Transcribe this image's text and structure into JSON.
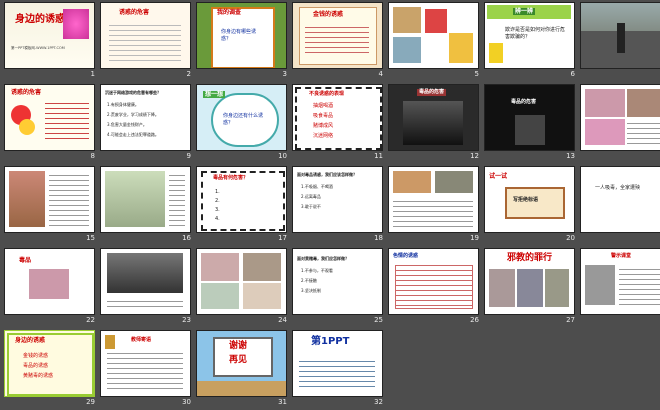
{
  "slides": [
    {
      "number": "1",
      "title": "身边的诱惑",
      "subtitle": "第一PPT模板网-WWW.1PPT.COM"
    },
    {
      "number": "2",
      "title": "诱惑的危害"
    },
    {
      "number": "3",
      "heading": "我的调查",
      "question": "你身边有哪些诱惑？"
    },
    {
      "number": "4",
      "title": "金钱的诱惑"
    },
    {
      "number": "5"
    },
    {
      "number": "6",
      "badge": "辨一辨",
      "text": "欺诈是否是如何对你进行危害欺骗的？"
    },
    {
      "number": "7"
    },
    {
      "number": "8",
      "title": "诱惑的危害"
    },
    {
      "number": "9",
      "heading": "沉迷于网络游戏的危害有哪些？",
      "items": [
        "1.有损身体健康。",
        "2.荒废学业，学习成绩下降。",
        "3.危害大量金钱财产。",
        "4.可能会走上违法犯罪道路。"
      ]
    },
    {
      "number": "10",
      "badge": "想一想",
      "text": "你身边还有什么诱惑？"
    },
    {
      "number": "11",
      "heading": "不良诱惑的表现",
      "items": [
        "抽烟喝酒",
        "吸食毒品",
        "赌博成风",
        "沉迷网络"
      ]
    },
    {
      "number": "12",
      "caption": "毒品的危害"
    },
    {
      "number": "13",
      "caption": "毒品的危害"
    },
    {
      "number": "14"
    },
    {
      "number": "15"
    },
    {
      "number": "16"
    },
    {
      "number": "17",
      "heading": "毒品有何危害？",
      "items": [
        "1.",
        "2.",
        "3.",
        "4."
      ]
    },
    {
      "number": "18",
      "heading": "面对毒品诱惑，我们应该怎样做？",
      "items": [
        "1.不吸烟、不喝酒",
        "2.远离毒品",
        "3.敢于说不"
      ]
    },
    {
      "number": "19"
    },
    {
      "number": "20",
      "badge": "试一试",
      "text": "写拒绝标语"
    },
    {
      "number": "21",
      "text": "一人吸毒，全家遭殃"
    },
    {
      "number": "22",
      "title": "毒品"
    },
    {
      "number": "23"
    },
    {
      "number": "24"
    },
    {
      "number": "25",
      "heading": "面对黄赌毒，我们应怎样做？",
      "items": [
        "1.不参与，不观看",
        "2.不接触",
        "3.坚决抵制"
      ]
    },
    {
      "number": "26",
      "heading": "色情的诱惑"
    },
    {
      "number": "27",
      "title": "邪教的罪行"
    },
    {
      "number": "28",
      "heading": "警示课堂"
    },
    {
      "number": "29",
      "title": "身边的诱惑",
      "items": [
        "金钱的诱惑",
        "毒品的诱惑",
        "黄赌毒的诱惑"
      ]
    },
    {
      "number": "30",
      "title": "教师寄语"
    },
    {
      "number": "31",
      "title": "谢谢",
      "subtitle": "再见"
    },
    {
      "number": "32",
      "brand": "第1PPT"
    }
  ],
  "colors": {
    "background": "#4d4d4d",
    "number": "#eaeaea",
    "accent_red": "#cc0000",
    "accent_blue": "#1030a0"
  }
}
